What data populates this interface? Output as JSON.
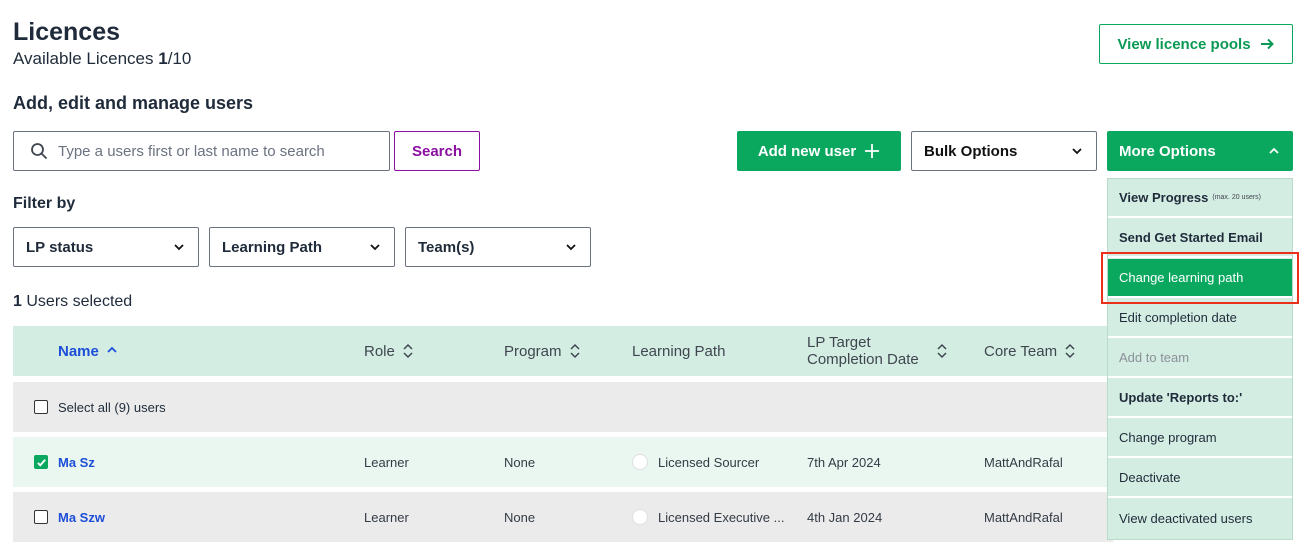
{
  "header": {
    "title": "Licences",
    "available_label": "Available Licences",
    "available_used": "1",
    "available_total": "/10",
    "pools_button": "View licence pools"
  },
  "section_title": "Add, edit and manage users",
  "search": {
    "placeholder": "Type a users first or last name to search",
    "button": "Search"
  },
  "toolbar": {
    "add_user": "Add new user",
    "bulk_options": "Bulk Options",
    "more_options": "More Options"
  },
  "filters": {
    "label": "Filter by",
    "items": [
      {
        "label": "LP status"
      },
      {
        "label": "Learning Path"
      },
      {
        "label": "Team(s)"
      }
    ]
  },
  "selection": {
    "count": "1",
    "label": "Users selected"
  },
  "table": {
    "columns": [
      {
        "label": "Name"
      },
      {
        "label": "Role"
      },
      {
        "label": "Program"
      },
      {
        "label": "Learning Path"
      },
      {
        "label_line1": "LP Target",
        "label_line2": "Completion Date"
      },
      {
        "label": "Core Team"
      }
    ],
    "select_all": "Select all (9) users",
    "rows": [
      {
        "name": "Ma Sz",
        "role": "Learner",
        "program": "None",
        "learning_path": "Licensed Sourcer",
        "date": "7th Apr 2024",
        "team": "MattAndRafal",
        "checked": true
      },
      {
        "name": "Ma Szw",
        "role": "Learner",
        "program": "None",
        "learning_path": "Licensed Executive ...",
        "date": "4th Jan 2024",
        "team": "MattAndRafal",
        "checked": false
      }
    ]
  },
  "more_menu": {
    "items": [
      {
        "label": "View Progress",
        "note": "(max. 20 users)"
      },
      {
        "label": "Send Get Started Email"
      },
      {
        "label": "Change learning path"
      },
      {
        "label": "Edit completion date"
      },
      {
        "label": "Add to team"
      },
      {
        "label": "Update 'Reports to:'"
      },
      {
        "label": "Change program"
      },
      {
        "label": "Deactivate"
      },
      {
        "label": "View deactivated users"
      }
    ]
  },
  "colors": {
    "accent_green": "#0aa85f",
    "search_purple": "#8b0fa0",
    "link_blue": "#1d4ed8",
    "header_bg": "#d4ede2",
    "highlight_red": "#e8301c"
  }
}
